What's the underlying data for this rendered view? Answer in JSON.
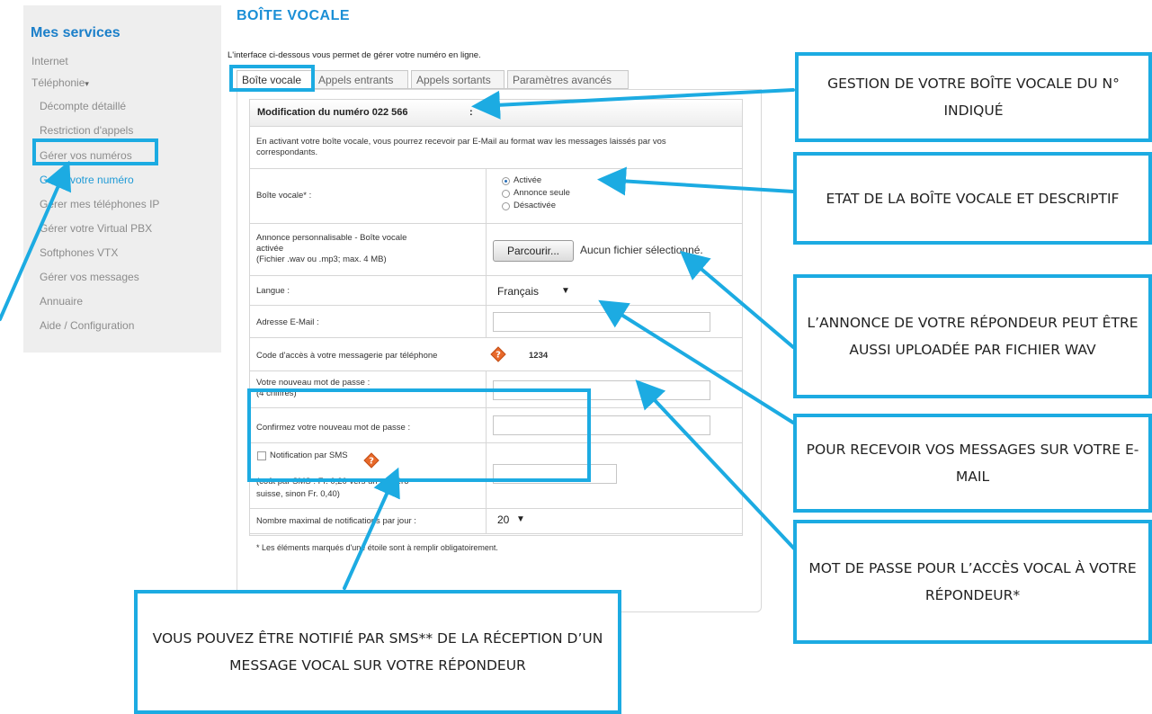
{
  "sidebar": {
    "title": "Mes services",
    "items": [
      {
        "label": "Internet"
      },
      {
        "label": "Téléphonie",
        "caret": "▾"
      },
      {
        "label": "Décompte détaillé"
      },
      {
        "label": "Restriction d'appels"
      },
      {
        "label": "Gérer vos numéros"
      },
      {
        "label": "Gérer votre numéro"
      },
      {
        "label": "Gérer mes téléphones IP"
      },
      {
        "label": "Gérer votre Virtual PBX"
      },
      {
        "label": "Softphones VTX"
      },
      {
        "label": "Gérer vos messages"
      },
      {
        "label": "Annuaire"
      },
      {
        "label": "Aide / Configuration"
      }
    ]
  },
  "page": {
    "title": "BOÎTE VOCALE",
    "intro": "L'interface ci-dessous vous permet de gérer votre numéro en ligne."
  },
  "tabs": [
    "Boîte vocale",
    "Appels entrants",
    "Appels sortants",
    "Paramètres avancés"
  ],
  "form": {
    "header": "Modification du numéro 022 566",
    "header_colon": ":",
    "description": "En activant votre boîte vocale, vous pourrez recevoir par E-Mail au format wav les messages laissés par vos correspondants.",
    "voicemail_label": "Boîte vocale* :",
    "voicemail_options": [
      "Activée",
      "Annonce seule",
      "Désactivée"
    ],
    "announce_label_1": "Annonce personnalisable - Boîte vocale",
    "announce_label_2": "activée",
    "announce_label_3": "(Fichier .wav ou .mp3; max. 4 MB)",
    "browse_button": "Parcourir...",
    "no_file": "Aucun fichier sélectionné.",
    "language_label": "Langue :",
    "language_value": "Français",
    "email_label": "Adresse E-Mail :",
    "access_code_label": "Code d'accès à votre messagerie par téléphone",
    "access_code_value": "1234",
    "new_pass_label_1": "Votre nouveau mot de passe :",
    "new_pass_label_2": "(4 chiffres)",
    "confirm_pass_label": "Confirmez votre nouveau mot de passe :",
    "sms_label": "Notification par SMS",
    "sms_cost_1": "(coût par SMS : Fr. 0,20 vers un numéro",
    "sms_cost_2": "suisse, sinon Fr. 0,40)",
    "max_notif_label": "Nombre maximal de notifications par jour :",
    "max_notif_value": "20",
    "required_note": "* Les éléments marqués d'une étoile sont à remplir obligatoirement."
  },
  "callouts": {
    "c1": "GESTION DE VOTRE BOÎTE VOCALE DU N° INDIQUÉ",
    "c2": "ETAT DE LA BOÎTE VOCALE ET DESCRIPTIF",
    "c3": "L’ANNONCE DE VOTRE RÉPONDEUR PEUT ÊTRE AUSSI UPLOADÉE PAR FICHIER WAV",
    "c4": "POUR RECEVOIR VOS MESSAGES SUR VOTRE E-MAIL",
    "c5": "MOT DE PASSE POUR L’ACCÈS VOCAL À VOTRE RÉPONDEUR*",
    "c6": "VOUS POUVEZ ÊTRE NOTIFIÉ PAR SMS** DE LA RÉCEPTION D’UN MESSAGE VOCAL SUR VOTRE RÉPONDEUR"
  },
  "colors": {
    "accent": "#1cabe2",
    "title_blue": "#1b8fd6",
    "link_blue": "#1f9ad6",
    "help_orange": "#e8692a"
  },
  "icons": {
    "help": "help-icon",
    "dropdown": "chevron-down-icon"
  }
}
